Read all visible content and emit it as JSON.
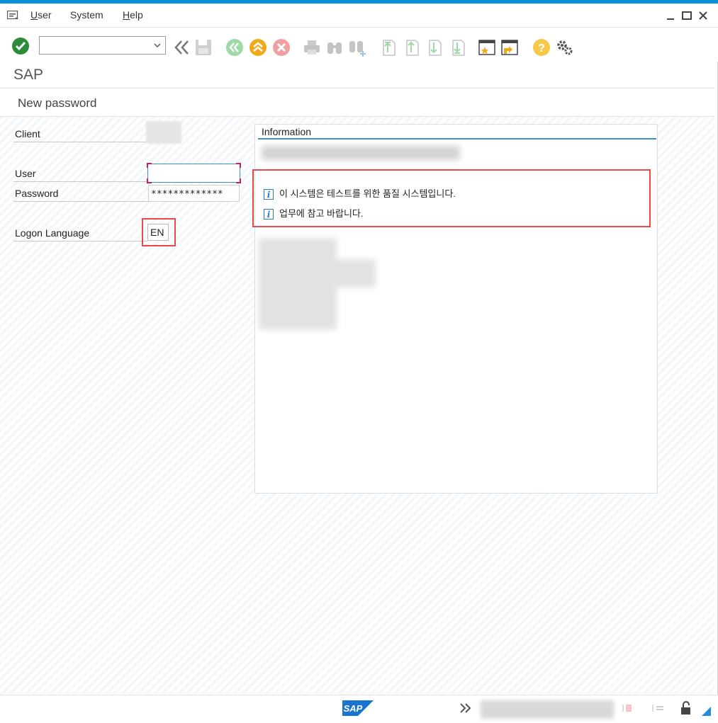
{
  "menu": {
    "items": [
      {
        "label": "User",
        "accel": "U",
        "rest": "ser"
      },
      {
        "label": "System",
        "accel": "S",
        "rest": "ystem"
      },
      {
        "label": "Help",
        "accel": "H",
        "rest": "elp"
      }
    ]
  },
  "toolbar": {
    "command_field_value": "",
    "icons": [
      "enter-icon",
      "back-icon",
      "save-icon",
      "green-back-icon",
      "exit-icon",
      "cancel-icon",
      "print-icon",
      "find-icon",
      "find-next-icon",
      "first-page-icon",
      "previous-page-icon",
      "next-page-icon",
      "last-page-icon",
      "create-session-icon",
      "generate-shortcut-icon",
      "help-icon",
      "customize-icon"
    ]
  },
  "app": {
    "title": "SAP",
    "screen_title": "New password"
  },
  "form": {
    "client_label": "Client",
    "user_label": "User",
    "user_value": "",
    "password_label": "Password",
    "password_value": "*************",
    "language_label": "Logon Language",
    "language_value": "EN"
  },
  "info": {
    "title": "Information",
    "messages": [
      "이 시스템은 테스트를 위한 품질 시스템입니다.",
      "업무에 참고 바랍니다."
    ]
  },
  "status": {
    "logo": "SAP"
  },
  "colors": {
    "accent": "#0a8fd8",
    "highlight_box": "#e34b4b",
    "field_focus": "#3f8fc9"
  }
}
